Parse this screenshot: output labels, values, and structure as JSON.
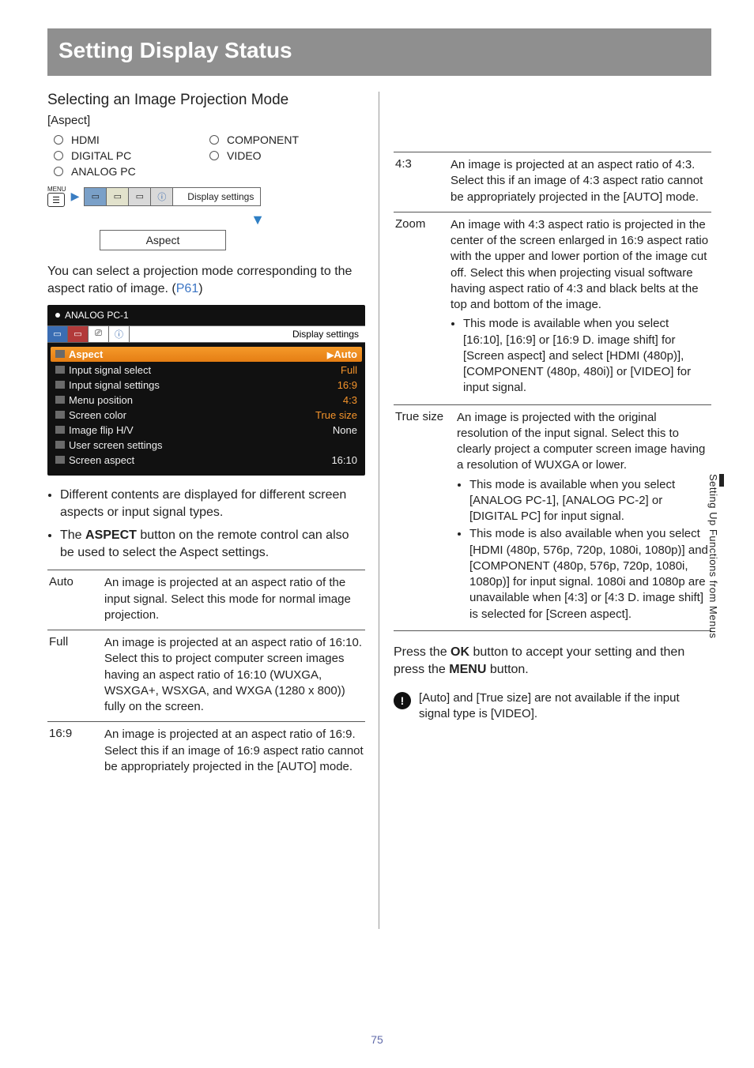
{
  "title": "Setting Display Status",
  "section_heading": "Selecting an Image Projection Mode",
  "bracket_label": "[Aspect]",
  "inputs": [
    "HDMI",
    "COMPONENT",
    "DIGITAL PC",
    "VIDEO",
    "ANALOG PC"
  ],
  "menu_label": "MENU",
  "menu_path_label": "Display settings",
  "aspect_box": "Aspect",
  "intro_text_prefix": "You can select a projection mode corresponding to the aspect ratio of image. (",
  "intro_link": "P61",
  "intro_text_suffix": ")",
  "osd": {
    "title": "ANALOG PC-1",
    "tab_label": "Display settings",
    "rows": [
      {
        "name": "Aspect",
        "value": "Auto",
        "sel": true
      },
      {
        "name": "Input signal select",
        "value": "Full",
        "sel": false,
        "orange": true
      },
      {
        "name": "Input signal settings",
        "value": "16:9",
        "sel": false,
        "orange": true
      },
      {
        "name": "Menu position",
        "value": "4:3",
        "sel": false,
        "orange": true
      },
      {
        "name": "Screen color",
        "value": "True size",
        "sel": false,
        "orange": true
      },
      {
        "name": "Image flip H/V",
        "value": "None",
        "sel": false
      },
      {
        "name": "User screen settings",
        "value": "",
        "sel": false
      },
      {
        "name": "Screen aspect",
        "value": "16:10",
        "sel": false
      }
    ]
  },
  "bullets": [
    "Different contents are displayed for different screen aspects or input signal types.",
    "The ASPECT button on the remote control can also be used to select the Aspect settings."
  ],
  "bullets_bold_word": "ASPECT",
  "defs_left": [
    {
      "label": "Auto",
      "body": "An image is projected at an aspect ratio of the input signal. Select this mode for normal image projection."
    },
    {
      "label": "Full",
      "body": "An image is projected at an aspect ratio of 16:10.\nSelect this to project computer screen images having an aspect ratio of 16:10 (WUXGA, WSXGA+, WSXGA, and WXGA (1280 x 800)) fully on the screen."
    },
    {
      "label": "16:9",
      "body": "An image is projected at an aspect ratio of 16:9. Select this if an image of 16:9 aspect ratio cannot be appropriately projected in the [AUTO] mode."
    }
  ],
  "defs_right": [
    {
      "label": "4:3",
      "body": "An image is projected at an aspect ratio of 4:3. Select this if an image of 4:3 aspect ratio cannot be appropriately projected in the [AUTO] mode.",
      "sub": []
    },
    {
      "label": "Zoom",
      "body": "An image with 4:3 aspect ratio is projected in the center of the screen enlarged in 16:9 aspect ratio with the upper and lower portion of the image cut off. Select this when projecting visual software having aspect ratio of 4:3 and black belts at the top and bottom of the image.",
      "sub": [
        "This mode is available when you select [16:10], [16:9] or [16:9 D. image shift] for [Screen aspect] and select [HDMI (480p)], [COMPONENT (480p, 480i)] or [VIDEO] for input signal."
      ]
    },
    {
      "label": "True size",
      "body": "An image is projected with the original resolution of the input signal. Select this to clearly project a computer screen image having a resolution of WUXGA or lower.",
      "sub": [
        "This mode is available when you select [ANALOG PC-1], [ANALOG PC-2] or [DIGITAL PC] for input signal.",
        "This mode is also available when you select [HDMI (480p, 576p, 720p, 1080i, 1080p)] and [COMPONENT (480p, 576p, 720p, 1080i, 1080p)] for input signal. 1080i and 1080p are unavailable when [4:3] or [4:3 D. image shift] is selected for [Screen aspect]."
      ]
    }
  ],
  "press_prefix": "Press the ",
  "press_ok": "OK",
  "press_mid": " button to accept your setting and then press the ",
  "press_menu": "MENU",
  "press_suffix": " button.",
  "footnote": "[Auto] and [True size] are not available if the input signal type is [VIDEO].",
  "side_tab": "Setting Up Functions from Menus",
  "page_number": "75"
}
